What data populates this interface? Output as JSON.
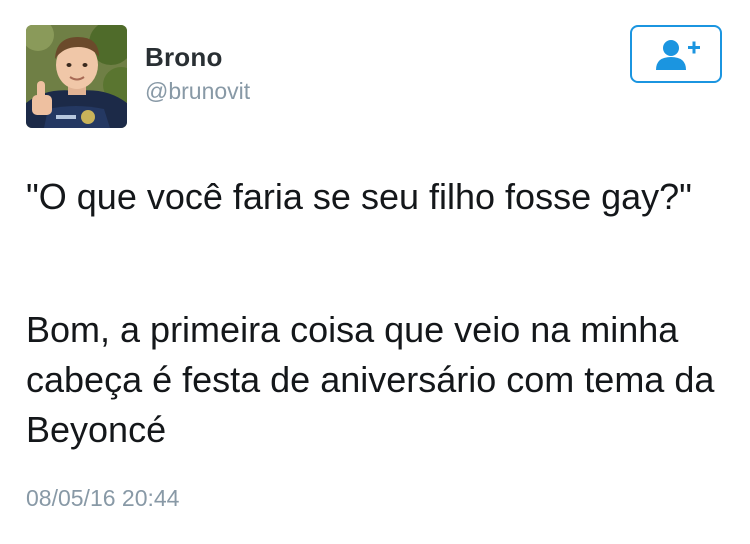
{
  "author": {
    "name": "Brono",
    "handle": "@brunovit"
  },
  "follow_button": {
    "icon": "add-user-icon"
  },
  "tweet": {
    "paragraphs": [
      "\"O que você faria se seu filho fosse gay?\"",
      "Bom, a primeira coisa que veio na minha cabeça é festa de aniversário com tema da Beyoncé"
    ],
    "timestamp": "08/05/16 20:44"
  },
  "colors": {
    "accent": "#1b95e0",
    "text": "#14171a",
    "secondary_text": "#8899a6"
  }
}
